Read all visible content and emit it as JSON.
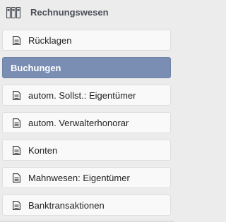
{
  "header": {
    "title": "Rechnungswesen",
    "icon": "binders-icon"
  },
  "colors": {
    "active_background": "#7a8db3",
    "panel_background": "#ececec",
    "item_background": "#f9f9f9"
  },
  "menu": {
    "items": [
      {
        "label": "Rücklagen",
        "icon": "document-icon",
        "active": false
      },
      {
        "label": "Buchungen",
        "icon": "document-icon",
        "active": true
      },
      {
        "label": "autom. Sollst.: Eigentümer",
        "icon": "document-icon",
        "active": false
      },
      {
        "label": "autom. Verwalterhonorar",
        "icon": "document-icon",
        "active": false
      },
      {
        "label": "Konten",
        "icon": "document-icon",
        "active": false
      },
      {
        "label": "Mahnwesen: Eigentümer",
        "icon": "document-icon",
        "active": false
      },
      {
        "label": "Banktransaktionen",
        "icon": "document-icon",
        "active": false
      }
    ]
  }
}
